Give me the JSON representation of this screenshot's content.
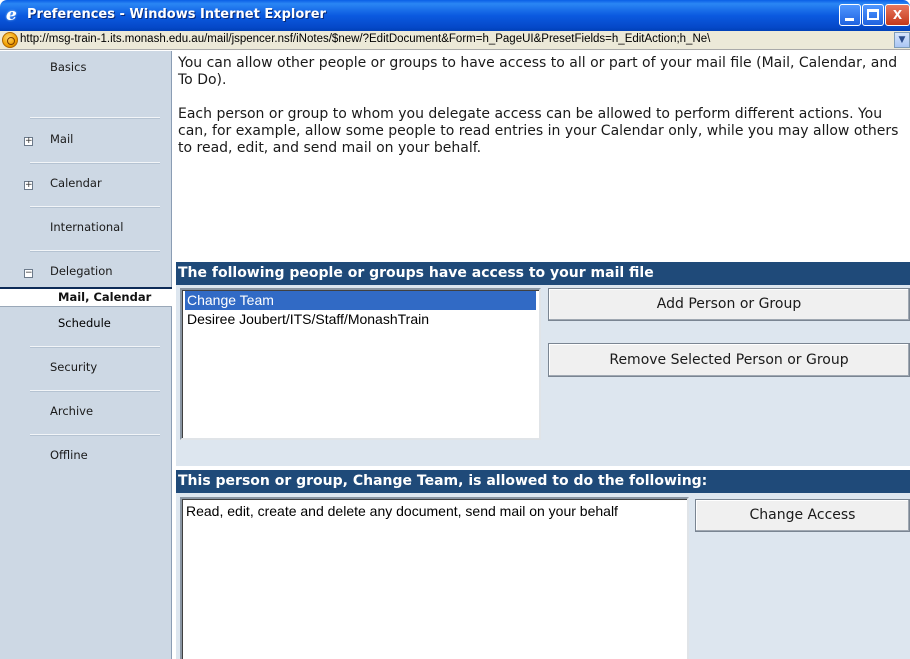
{
  "window": {
    "title": "Preferences - Windows Internet Explorer",
    "minimize": "",
    "maximize": "",
    "close": "X"
  },
  "addressbar": {
    "url": "http://msg-train-1.its.monash.edu.au/mail/jspencer.nsf/iNotes/$new/?EditDocument&Form=h_PageUI&PresetFields=h_EditAction;h_Ne\\"
  },
  "sidebar": {
    "basics": "Basics",
    "mail": "Mail",
    "calendar": "Calendar",
    "international": "International",
    "delegation": "Delegation",
    "mail_calendar": "Mail, Calendar",
    "schedule": "Schedule",
    "security": "Security",
    "archive": "Archive",
    "offline": "Offline",
    "expand_symbol": "+",
    "collapse_symbol": "−"
  },
  "main": {
    "intro_p1": "You can allow other people or groups to have access to all or part of your mail file (Mail, Calendar, and To Do).",
    "intro_p2": "Each person or group to whom you delegate access can be allowed to perform different actions. You can, for example, allow some people to read entries in your Calendar only, while you may allow others to read, edit, and send mail on your behalf.",
    "access_header": "The following people or groups have access to your mail file",
    "people": [
      {
        "name": "Change Team",
        "selected": true
      },
      {
        "name": "Desiree Joubert/ITS/Staff/MonashTrain",
        "selected": false
      }
    ],
    "add_button": "Add Person or Group",
    "remove_button": "Remove Selected Person or Group",
    "permissions_header": "This person or group, Change Team, is allowed to do the following:",
    "permissions_text": "Read, edit, create and delete any document, send mail on your behalf",
    "change_access_button": "Change Access"
  },
  "colors": {
    "titlebar": "#0b5ae0",
    "section_header": "#1f4a79",
    "sidebar": "#cdd8e4",
    "panel": "#dde6ef",
    "selection": "#316ac5"
  }
}
